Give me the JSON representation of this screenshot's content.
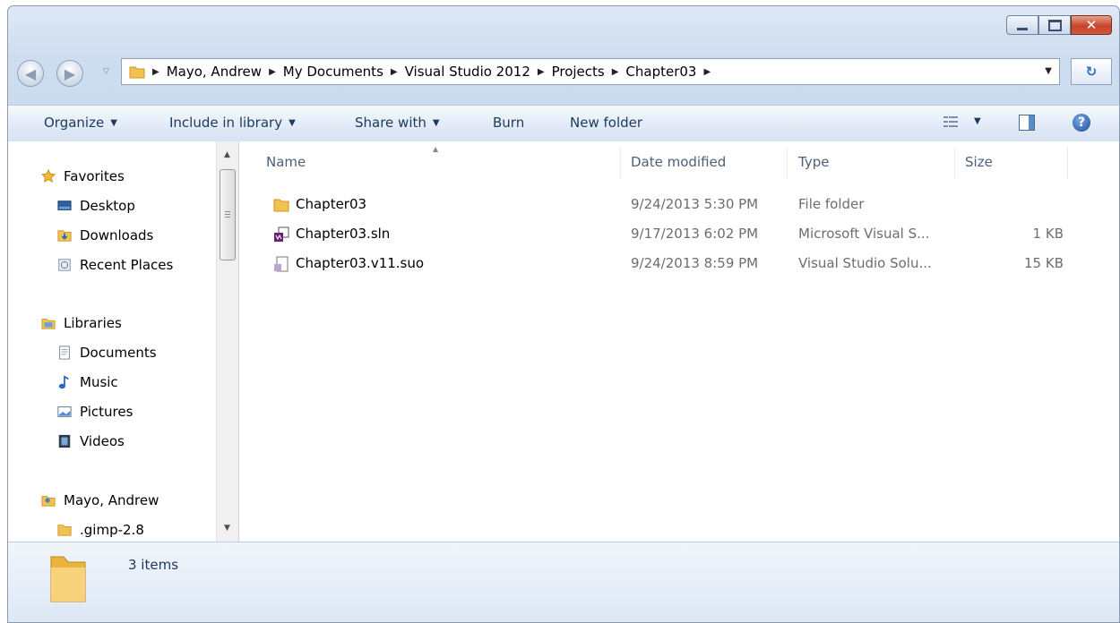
{
  "breadcrumb": [
    "Mayo, Andrew",
    "My Documents",
    "Visual Studio 2012",
    "Projects",
    "Chapter03"
  ],
  "toolbar": {
    "organize": "Organize",
    "include_in_library": "Include in library",
    "share_with": "Share with",
    "burn": "Burn",
    "new_folder": "New folder"
  },
  "nav": {
    "favorites": "Favorites",
    "desktop": "Desktop",
    "downloads": "Downloads",
    "recent_places": "Recent Places",
    "libraries": "Libraries",
    "documents": "Documents",
    "music": "Music",
    "pictures": "Pictures",
    "videos": "Videos",
    "user": "Mayo, Andrew",
    "gimp": ".gimp-2.8"
  },
  "columns": {
    "name": "Name",
    "date_modified": "Date modified",
    "type": "Type",
    "size": "Size"
  },
  "files": [
    {
      "name": "Chapter03",
      "date": "9/24/2013 5:30 PM",
      "type": "File folder",
      "size": "",
      "icon": "folder-icon"
    },
    {
      "name": "Chapter03.sln",
      "date": "9/17/2013 6:02 PM",
      "type": "Microsoft Visual S...",
      "size": "1 KB",
      "icon": "solution-file-icon"
    },
    {
      "name": "Chapter03.v11.suo",
      "date": "9/24/2013 8:59 PM",
      "type": "Visual Studio Solu...",
      "size": "15 KB",
      "icon": "suo-file-icon"
    }
  ],
  "details": {
    "count": "3 items"
  },
  "colors": {
    "toolbar_text": "#1e395b",
    "close_button": "#c4442b",
    "folder": "#f2c14e"
  }
}
